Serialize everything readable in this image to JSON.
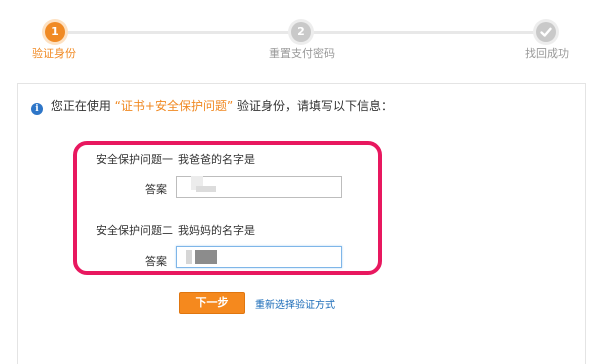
{
  "steps": [
    {
      "number": "1",
      "label": "验证身份",
      "state": "active"
    },
    {
      "number": "2",
      "label": "重置支付密码",
      "state": "todo"
    },
    {
      "number": "",
      "label": "找回成功",
      "state": "todo"
    }
  ],
  "info": {
    "prefix": "您正在使用",
    "quote_open": "“",
    "highlight": "证书+安全保护问题",
    "quote_close": "”",
    "suffix": "验证身份，请填写以下信息："
  },
  "questions": [
    {
      "label": "安全保护问题一",
      "question": "我爸爸的名字是",
      "answer_label": "答案",
      "answer_value": ""
    },
    {
      "label": "安全保护问题二",
      "question": "我妈妈的名字是",
      "answer_label": "答案",
      "answer_value": ""
    }
  ],
  "actions": {
    "next_label": "下一步",
    "reselect_label": "重新选择验证方式"
  },
  "colors": {
    "accent": "#f08a24",
    "highlight_frame": "#e8185f",
    "link": "#1a6bb8"
  }
}
